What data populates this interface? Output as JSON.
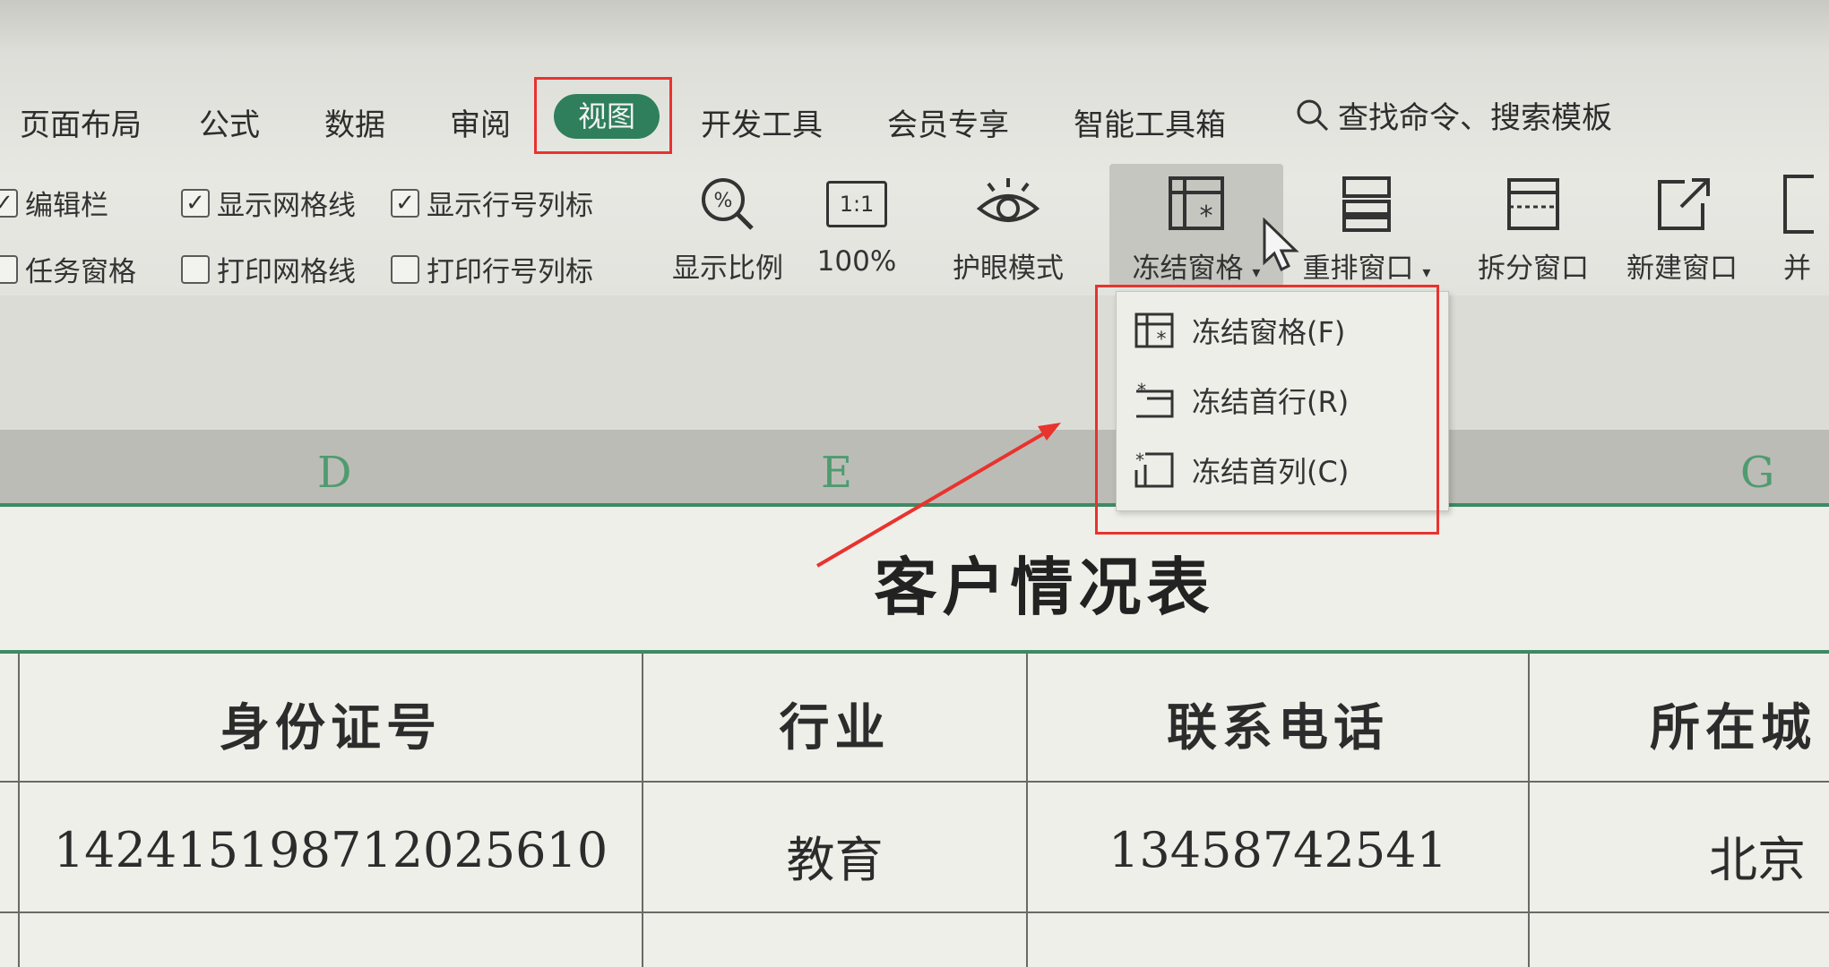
{
  "ribbon": {
    "tabs": [
      "页面布局",
      "公式",
      "数据",
      "审阅",
      "视图",
      "开发工具",
      "会员专享",
      "智能工具箱"
    ],
    "active_tab": "视图",
    "search_label": "查找命令、搜索模板",
    "checkboxes": {
      "edit_bar": {
        "label": "编辑栏",
        "checked": true
      },
      "task_pane": {
        "label": "任务窗格",
        "checked": false
      },
      "show_gridlines": {
        "label": "显示网格线",
        "checked": true
      },
      "print_gridlines": {
        "label": "打印网格线",
        "checked": false
      },
      "show_headers": {
        "label": "显示行号列标",
        "checked": true
      },
      "print_headers": {
        "label": "打印行号列标",
        "checked": false
      }
    },
    "tools": {
      "zoom": "显示比例",
      "hundred": "100%",
      "hundred_icon": "1:1",
      "eye_care": "护眼模式",
      "freeze": "冻结窗格",
      "rearrange": "重排窗口",
      "split": "拆分窗口",
      "new_window": "新建窗口",
      "more": "并"
    }
  },
  "dropdown": {
    "items": [
      "冻结窗格(F)",
      "冻结首行(R)",
      "冻结首列(C)"
    ]
  },
  "columns": [
    "D",
    "E",
    "G"
  ],
  "sheet": {
    "title": "客户情况表",
    "headers": [
      "身份证号",
      "行业",
      "联系电话",
      "所在城"
    ],
    "rows": [
      [
        "142415198712025610",
        "教育",
        "13458742541",
        "北京"
      ]
    ]
  },
  "colors": {
    "accent_green": "#2f7f5c",
    "highlight_red": "#e8332f"
  }
}
